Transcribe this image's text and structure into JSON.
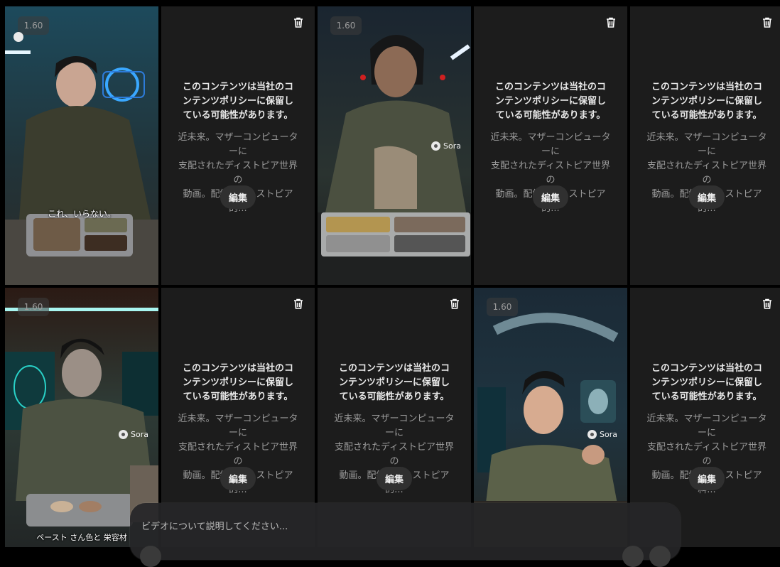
{
  "tiles": {
    "policy_title": "このコンテンツは当社のコンテンツポリシーに保留している可能性があります。",
    "policy_title_lines": [
      "このコンテンツは当社のコ",
      "ンテンツポリシーに保留し",
      "ている可能性があります。"
    ],
    "desc_lines_a": [
      "近未来。マザーコンピューターに",
      "支配されたディストピア世界の",
      "動画。配給のディストピア的..."
    ],
    "desc_lines_b": [
      "近未来。マザーコンピューターに",
      "支配されたディストピア世界の",
      "動画。配給のディストピア料..."
    ],
    "edit_label": "編集",
    "badge": "1.60",
    "sora_label": "Sora",
    "caption_1": "これ、いらない。",
    "caption_6": "ペースト さん色と 栄容材"
  },
  "prompt": {
    "placeholder": "ビデオについて説明してください..."
  },
  "icons": {
    "trash": "trash-icon",
    "sora": "sora-logo-icon"
  },
  "colors": {
    "background": "#000000",
    "tile": "#1c1c1c",
    "edit_button": "#303030"
  }
}
